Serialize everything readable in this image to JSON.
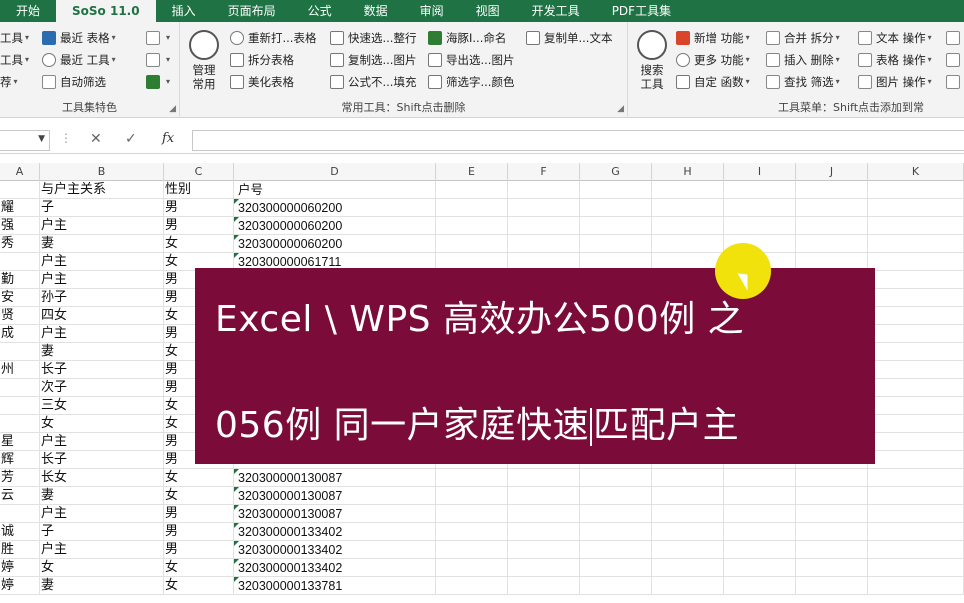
{
  "ribbon": {
    "tabs": [
      {
        "label": "开始",
        "active": false
      },
      {
        "label": "SoSo 11.0",
        "active": true
      },
      {
        "label": "插入",
        "active": false
      },
      {
        "label": "页面布局",
        "active": false
      },
      {
        "label": "公式",
        "active": false
      },
      {
        "label": "数据",
        "active": false
      },
      {
        "label": "审阅",
        "active": false
      },
      {
        "label": "视图",
        "active": false
      },
      {
        "label": "开发工具",
        "active": false
      },
      {
        "label": "PDF工具集",
        "active": false
      }
    ],
    "group1": {
      "items": [
        "工具",
        "工具",
        "荐"
      ],
      "col2": [
        "最近 表格",
        "最近 工具",
        "自动筛选"
      ],
      "label": "工具集特色"
    },
    "group2": {
      "big_button": "管理\n常用",
      "col1": [
        "重新打...表格",
        "拆分表格",
        "美化表格"
      ],
      "col2": [
        "快速选...整行",
        "复制选...图片",
        "公式不...填充"
      ],
      "col3": [
        "海豚I...命名",
        "导出选...图片",
        "筛选字...颜色"
      ],
      "col4": [
        "复制单...文本"
      ],
      "label": "常用工具：Shift点击删除"
    },
    "group3": {
      "big_button": "搜索\n工具",
      "col1": [
        "新增 功能",
        "更多 功能",
        "自定 函数"
      ],
      "col2": [
        "合并 拆分",
        "插入 删除",
        "查找 筛选"
      ],
      "col3": [
        "文本 操作",
        "表格 操作",
        "图片 操作"
      ],
      "label": "工具菜单：Shift点击添加到常"
    }
  },
  "formula_bar": {
    "name_box": "",
    "cancel": "✕",
    "confirm": "✓",
    "fx": "fx",
    "value": ""
  },
  "columns": [
    "A",
    "B",
    "C",
    "D",
    "E",
    "F",
    "G",
    "H",
    "I",
    "J",
    "K"
  ],
  "rows": [
    [
      "",
      "与户主关系",
      "性别",
      "户号"
    ],
    [
      "耀",
      "子",
      "男",
      "320300000060200"
    ],
    [
      "强",
      "户主",
      "男",
      "320300000060200"
    ],
    [
      "秀",
      "妻",
      "女",
      "320300000060200"
    ],
    [
      "",
      "户主",
      "女",
      "320300000061711"
    ],
    [
      "勤",
      "户主",
      "男",
      ""
    ],
    [
      "安",
      "孙子",
      "男",
      ""
    ],
    [
      "贤",
      "四女",
      "女",
      ""
    ],
    [
      "成",
      "户主",
      "男",
      ""
    ],
    [
      "",
      "妻",
      "女",
      ""
    ],
    [
      "州",
      "长子",
      "男",
      ""
    ],
    [
      "",
      "次子",
      "男",
      ""
    ],
    [
      "",
      "三女",
      "女",
      ""
    ],
    [
      "",
      "女",
      "女",
      ""
    ],
    [
      "星",
      "户主",
      "男",
      ""
    ],
    [
      "辉",
      "长子",
      "男",
      ""
    ],
    [
      "芳",
      "长女",
      "女",
      "320300000130087"
    ],
    [
      "云",
      "妻",
      "女",
      "320300000130087"
    ],
    [
      "",
      "户主",
      "男",
      "320300000130087"
    ],
    [
      "诚",
      "子",
      "男",
      "320300000133402"
    ],
    [
      "胜",
      "户主",
      "男",
      "320300000133402"
    ],
    [
      "婷",
      "女",
      "女",
      "320300000133402"
    ],
    [
      "婷",
      "妻",
      "女",
      "320300000133781"
    ]
  ],
  "overlay": {
    "line1": "Excel \\ WPS 高效办公500例 之",
    "line2_before_cursor": "056例  同一户家庭快速",
    "line2_after_cursor": "匹配户主"
  }
}
